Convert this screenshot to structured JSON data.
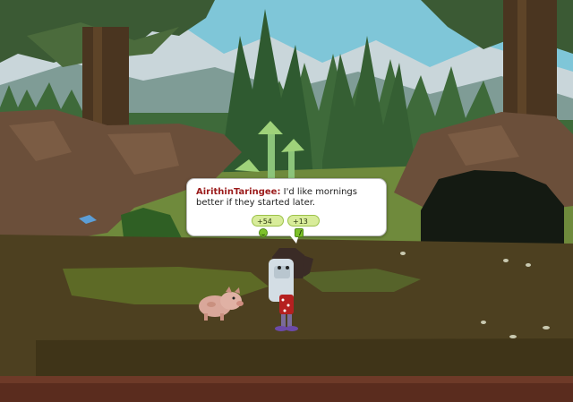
{
  "speech_bubble": {
    "speaker": "AirithinTaringee:",
    "message": "I'd like mornings better if they started later.",
    "reward_happiness": "+54",
    "reward_energy": "+13"
  },
  "icons": {
    "happiness": "smiley-face-icon",
    "energy": "lightning-bolt-icon"
  },
  "colors": {
    "speaker_name": "#9b1b1b",
    "reward_pill": "#d8ec9a",
    "sky": "#7cc4d6",
    "ground": "#4a3e1c"
  }
}
